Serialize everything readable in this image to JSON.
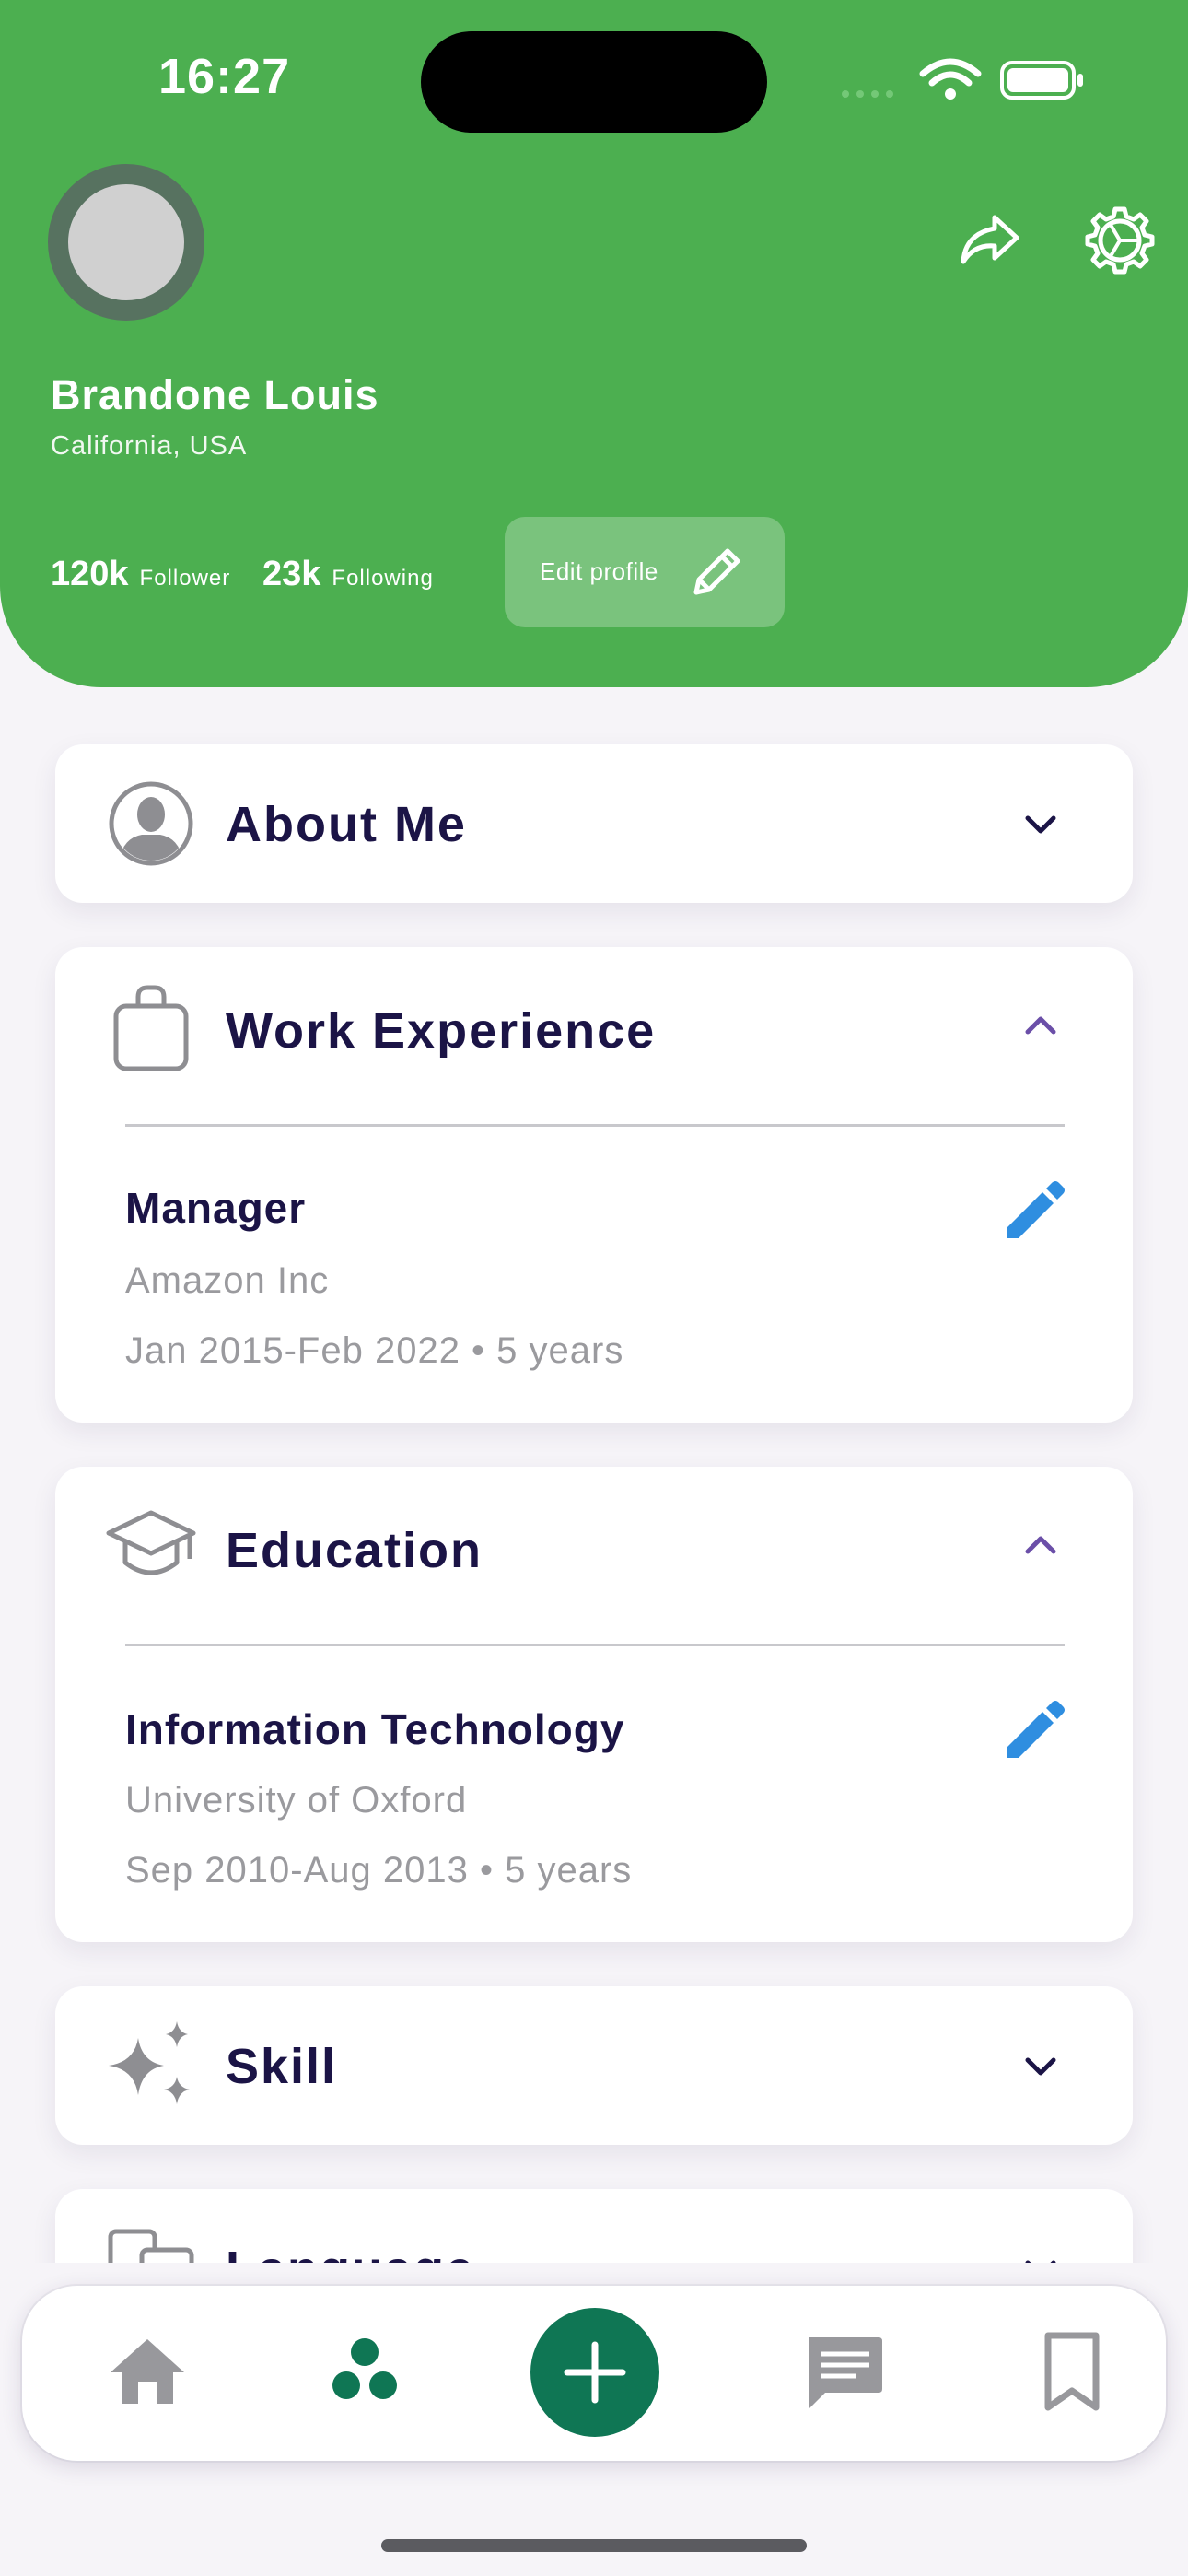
{
  "status_bar": {
    "time": "16:27"
  },
  "profile": {
    "name": "Brandone Louis",
    "location": "California, USA",
    "followers_count": "120k",
    "followers_label": "Follower",
    "following_count": "23k",
    "following_label": "Following",
    "edit_label": "Edit profile"
  },
  "sections": {
    "about": {
      "title": "About Me",
      "icon": "person-icon",
      "expanded": false
    },
    "work": {
      "title": "Work Experience",
      "icon": "briefcase-icon",
      "expanded": true,
      "entry": {
        "role": "Manager",
        "company": "Amazon Inc",
        "period": "Jan 2015-Feb 2022 • 5 years"
      }
    },
    "education": {
      "title": "Education",
      "icon": "graduation-cap-icon",
      "expanded": true,
      "entry": {
        "field": "Information Technology",
        "school": "University of Oxford",
        "period": "Sep 2010-Aug 2013 • 5 years"
      }
    },
    "skill": {
      "title": "Skill",
      "icon": "sparkle-icon",
      "expanded": false
    },
    "language": {
      "title": "Language",
      "icon": "translate-icon",
      "expanded": false
    }
  },
  "colors": {
    "header": "#4caf50",
    "accent": "#0f7654",
    "edit_icon": "#2f8ee0",
    "title_text": "#1b1446",
    "muted_text": "#9a9a9e"
  },
  "nav": {
    "items": [
      "home-icon",
      "community-icon",
      "add-icon",
      "chat-icon",
      "bookmark-icon"
    ],
    "active": "community-icon"
  }
}
